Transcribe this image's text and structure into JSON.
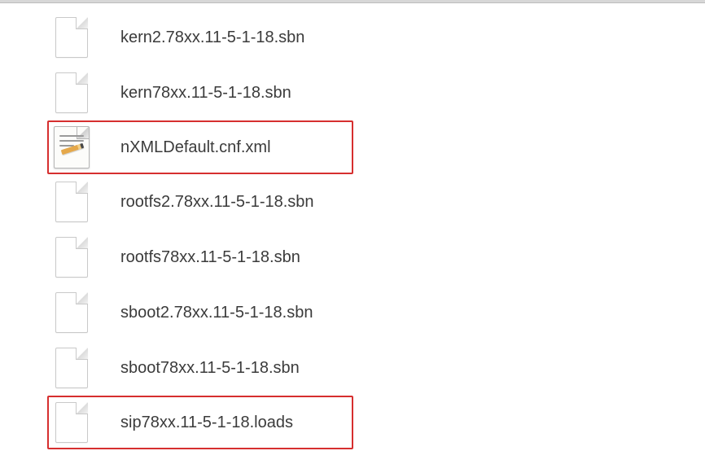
{
  "files": [
    {
      "name": "kern2.78xx.11-5-1-18.sbn",
      "iconType": "blank",
      "highlighted": false
    },
    {
      "name": "kern78xx.11-5-1-18.sbn",
      "iconType": "blank",
      "highlighted": false
    },
    {
      "name": "nXMLDefault.cnf.xml",
      "iconType": "content",
      "highlighted": true
    },
    {
      "name": "rootfs2.78xx.11-5-1-18.sbn",
      "iconType": "blank",
      "highlighted": false
    },
    {
      "name": "rootfs78xx.11-5-1-18.sbn",
      "iconType": "blank",
      "highlighted": false
    },
    {
      "name": "sboot2.78xx.11-5-1-18.sbn",
      "iconType": "blank",
      "highlighted": false
    },
    {
      "name": "sboot78xx.11-5-1-18.sbn",
      "iconType": "blank",
      "highlighted": false
    },
    {
      "name": "sip78xx.11-5-1-18.loads",
      "iconType": "blank",
      "highlighted": true
    }
  ]
}
